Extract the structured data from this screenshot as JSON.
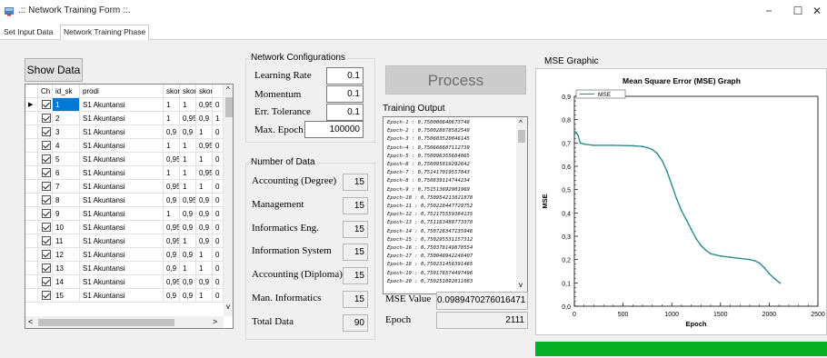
{
  "window": {
    "title": ".:: Network Training Form ::.",
    "minimize_glyph": "−",
    "maximize_glyph": "☐",
    "close_glyph": "✕"
  },
  "tabs": [
    {
      "label": "Set Input Data",
      "active": false
    },
    {
      "label": "Network Training Phase",
      "active": true
    }
  ],
  "show_data_button": "Show Data",
  "grid": {
    "columns": [
      "Ch",
      "id_sk",
      "prodi",
      "skor",
      "skor",
      "skor"
    ],
    "rows": [
      {
        "id": "1",
        "prodi": "S1 Akuntansi",
        "s1": "1",
        "s2": "1",
        "s3": "0,95",
        "s4": "0"
      },
      {
        "id": "2",
        "prodi": "S1 Akuntansi",
        "s1": "1",
        "s2": "0,95",
        "s3": "0,9",
        "s4": "1"
      },
      {
        "id": "3",
        "prodi": "S1 Akuntansi",
        "s1": "0,9",
        "s2": "0,9",
        "s3": "1",
        "s4": "0"
      },
      {
        "id": "4",
        "prodi": "S1 Akuntansi",
        "s1": "1",
        "s2": "1",
        "s3": "0,95",
        "s4": "0"
      },
      {
        "id": "5",
        "prodi": "S1 Akuntansi",
        "s1": "0,95",
        "s2": "1",
        "s3": "1",
        "s4": "0"
      },
      {
        "id": "6",
        "prodi": "S1 Akuntansi",
        "s1": "1",
        "s2": "1",
        "s3": "0,95",
        "s4": "0"
      },
      {
        "id": "7",
        "prodi": "S1 Akuntansi",
        "s1": "0,95",
        "s2": "1",
        "s3": "1",
        "s4": "0"
      },
      {
        "id": "8",
        "prodi": "S1 Akuntansi",
        "s1": "0,9",
        "s2": "0,95",
        "s3": "0,9",
        "s4": "0"
      },
      {
        "id": "9",
        "prodi": "S1 Akuntansi",
        "s1": "1",
        "s2": "0,9",
        "s3": "0,9",
        "s4": "0"
      },
      {
        "id": "10",
        "prodi": "S1 Akuntansi",
        "s1": "0,95",
        "s2": "0,9",
        "s3": "0,9",
        "s4": "0"
      },
      {
        "id": "11",
        "prodi": "S1 Akuntansi",
        "s1": "0,95",
        "s2": "1",
        "s3": "0,9",
        "s4": "0"
      },
      {
        "id": "12",
        "prodi": "S1 Akuntansi",
        "s1": "0,9",
        "s2": "0,9",
        "s3": "1",
        "s4": "0"
      },
      {
        "id": "13",
        "prodi": "S1 Akuntansi",
        "s1": "0,9",
        "s2": "1",
        "s3": "1",
        "s4": "0"
      },
      {
        "id": "14",
        "prodi": "S1 Akuntansi",
        "s1": "0,95",
        "s2": "0,9",
        "s3": "0,9",
        "s4": "0"
      },
      {
        "id": "15",
        "prodi": "S1 Akuntansi",
        "s1": "0,9",
        "s2": "0,9",
        "s3": "1",
        "s4": "0"
      }
    ],
    "row_marker_glyph": "▶",
    "scroll_up_glyph": "^",
    "scroll_down_glyph": "v",
    "scroll_left_glyph": "<",
    "scroll_right_glyph": ">"
  },
  "network_config": {
    "legend": "Network Configurations",
    "fields": [
      {
        "label": "Learning Rate",
        "value": "0.1"
      },
      {
        "label": "Momentum",
        "value": "0.1"
      },
      {
        "label": "Err. Tolerance",
        "value": "0.1"
      },
      {
        "label": "Max. Epoch",
        "value": "100000"
      }
    ]
  },
  "number_of_data": {
    "legend": "Number of Data",
    "fields": [
      {
        "label": "Accounting (Degree)",
        "value": "15"
      },
      {
        "label": "Management",
        "value": "15"
      },
      {
        "label": "Informatics Eng.",
        "value": "15"
      },
      {
        "label": "Information System",
        "value": "15"
      },
      {
        "label": "Accounting (Diploma)",
        "value": "15"
      },
      {
        "label": "Man. Informatics",
        "value": "15"
      },
      {
        "label": "Total Data",
        "value": "90"
      }
    ]
  },
  "process_button": "Process",
  "training_output": {
    "label": "Training Output",
    "lines": [
      "Epoch-1 : 0,750000640673748",
      "Epoch-2 : 0,750028878582549",
      "Epoch-3 : 0,750603520046145",
      "Epoch-4 : 0,750666687112739",
      "Epoch-5 : 0,750096355684065",
      "Epoch-6 : 0,750095819292642",
      "Epoch-7 : 0,751417019557843",
      "Epoch-8 : 0,750839114744234",
      "Epoch-9 : 0,751513692901969",
      "Epoch-10 : 0,750954213821878",
      "Epoch-11 : 0,750228447729752",
      "Epoch-12 : 0,752175559384135",
      "Epoch-13 : 0,751163488773378",
      "Epoch-14 : 0,750726347135946",
      "Epoch-15 : 0,750295531157312",
      "Epoch-16 : 0,750378149878554",
      "Epoch-17 : 0,750046942248407",
      "Epoch-18 : 0,750231456391465",
      "Epoch-19 : 0,750176574497496",
      "Epoch-20 : 0,750251092811083"
    ]
  },
  "mse_value": {
    "label": "MSE Value",
    "value": "0.0989470276016471"
  },
  "epoch": {
    "label": "Epoch",
    "value": "2111"
  },
  "mse_graphic": {
    "label": "MSE Graphic"
  },
  "progress": {
    "fraction": 1.0,
    "color": "#06b025"
  },
  "chart_data": {
    "type": "line",
    "title": "Mean Square Error (MSE) Graph",
    "xlabel": "Epoch",
    "ylabel": "MSE",
    "legend": [
      "MSE"
    ],
    "legend_position": "top-left",
    "xlim": [
      0,
      2500
    ],
    "ylim": [
      0,
      0.9
    ],
    "xticks": [
      "0",
      "500",
      "1000",
      "1500",
      "2000",
      "2500"
    ],
    "yticks": [
      "0,0",
      "0,1",
      "0,2",
      "0,3",
      "0,4",
      "0,5",
      "0,6",
      "0,7",
      "0,8",
      "0,9"
    ],
    "series_color": "#2e8b8b",
    "series": [
      {
        "name": "MSE",
        "x": [
          0,
          20,
          40,
          60,
          100,
          200,
          400,
          600,
          700,
          750,
          800,
          850,
          900,
          950,
          1000,
          1050,
          1100,
          1150,
          1200,
          1250,
          1300,
          1350,
          1400,
          1450,
          1500,
          1600,
          1700,
          1800,
          1850,
          1900,
          1950,
          2000,
          2050,
          2111
        ],
        "y": [
          0.75,
          0.745,
          0.73,
          0.7,
          0.695,
          0.69,
          0.69,
          0.688,
          0.685,
          0.68,
          0.672,
          0.655,
          0.625,
          0.58,
          0.52,
          0.46,
          0.41,
          0.37,
          0.33,
          0.29,
          0.26,
          0.24,
          0.225,
          0.22,
          0.215,
          0.21,
          0.205,
          0.2,
          0.195,
          0.185,
          0.165,
          0.14,
          0.12,
          0.099
        ]
      }
    ]
  }
}
